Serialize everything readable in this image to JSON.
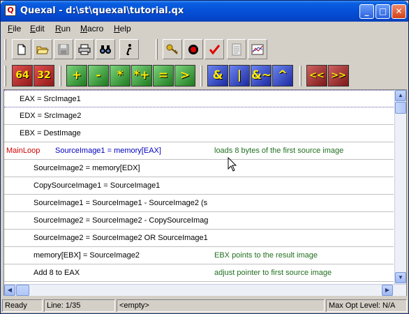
{
  "window": {
    "title": "Quexal - d:\\st\\quexal\\tutorial.qx",
    "app_icon_glyph": "Q",
    "controls": {
      "minimize": "_",
      "maximize": "□",
      "close": "✕"
    }
  },
  "menu": [
    {
      "first": "F",
      "rest": "ile"
    },
    {
      "first": "E",
      "rest": "dit"
    },
    {
      "first": "R",
      "rest": "un"
    },
    {
      "first": "M",
      "rest": "acro"
    },
    {
      "first": "H",
      "rest": "elp"
    }
  ],
  "toolbar1": {
    "icons": [
      "new-file-icon",
      "open-folder-icon",
      "save-disk-icon",
      "print-icon",
      "find-binoculars-icon",
      "info-icon",
      "key-icon",
      "record-icon",
      "check-icon",
      "document-gray-icon",
      "graph-icon"
    ]
  },
  "toolbar2": {
    "buttons": [
      "64",
      "32",
      "+",
      "-",
      "*",
      "*+",
      "=",
      ">",
      "&",
      "|",
      "&~",
      "^",
      "<<",
      ">>"
    ]
  },
  "editor": {
    "lines": [
      {
        "label": "",
        "code": "EAX = SrcImage1",
        "comment": ""
      },
      {
        "label": "",
        "code": "EDX = SrcImage2",
        "comment": ""
      },
      {
        "label": "",
        "code": "EBX = DestImage",
        "comment": ""
      },
      {
        "label": "MainLoop",
        "code": "SourceImage1 = memory[EAX]",
        "comment": "loads 8 bytes of the first source image"
      },
      {
        "label": "",
        "code": "SourceImage2 = memory[EDX]",
        "comment": ""
      },
      {
        "label": "",
        "code": "CopySourceImage1 = SourceImage1",
        "comment": ""
      },
      {
        "label": "",
        "code": "SourceImage1 = SourceImage1 - SourceImage2 (s",
        "comment": ""
      },
      {
        "label": "",
        "code": "SourceImage2 = SourceImage2 - CopySourceImag",
        "comment": ""
      },
      {
        "label": "",
        "code": "SourceImage2 = SourceImage2 OR SourceImage1",
        "comment": ""
      },
      {
        "label": "",
        "code": "memory[EBX] = SourceImage2",
        "comment": "EBX points to the result image"
      },
      {
        "label": "",
        "code": "Add 8 to EAX",
        "comment": "adjust pointer to first source image"
      }
    ]
  },
  "statusbar": {
    "state": "Ready",
    "line": "Line: 1/35",
    "info": "<empty>",
    "opt_level": "Max Opt Level: N/A"
  },
  "colors": {
    "label": "#d00000",
    "code_highlight": "#0000c0",
    "comment": "#207020",
    "titlebar": "#0550d8"
  }
}
